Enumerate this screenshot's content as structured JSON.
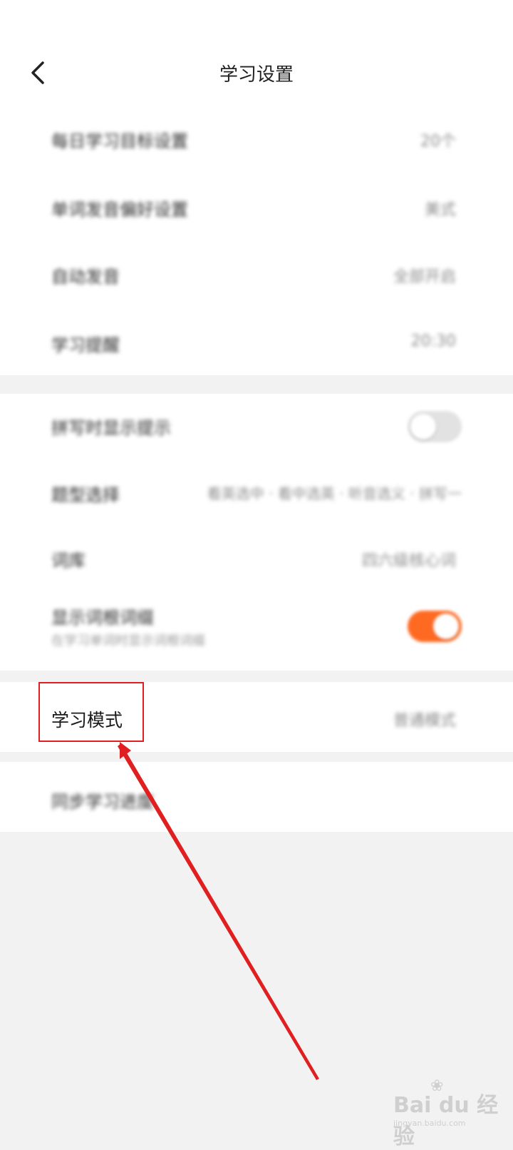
{
  "header": {
    "title": "学习设置",
    "back_icon": "chevron-left-icon"
  },
  "group1": {
    "items": [
      {
        "label": "每日学习目标设置",
        "value": "20个"
      },
      {
        "label": "单词发音偏好设置",
        "value": "美式"
      },
      {
        "label": "自动发音",
        "value": "全部开启"
      },
      {
        "label": "学习提醒",
        "value": "20:30"
      }
    ]
  },
  "group2": {
    "items": [
      {
        "label": "拼写时显示提示",
        "toggle": "off"
      },
      {
        "label": "题型选择",
        "value": "看英选中 · 看中选英 · 听音选义 · 拼写一"
      },
      {
        "label": "词库",
        "value": "四六级核心词"
      },
      {
        "label": "显示词根词缀",
        "sub": "在学习单词时显示词根词缀",
        "toggle": "on"
      }
    ]
  },
  "group3": {
    "label": "学习模式",
    "value": "普通模式"
  },
  "group4": {
    "label": "同步学习进度"
  },
  "colors": {
    "accent": "#ff6a22",
    "annotation": "#e02020",
    "background": "#f2f2f2"
  },
  "watermark": {
    "main": "Bai du 经验",
    "small": "jingyan.baidu.com"
  }
}
